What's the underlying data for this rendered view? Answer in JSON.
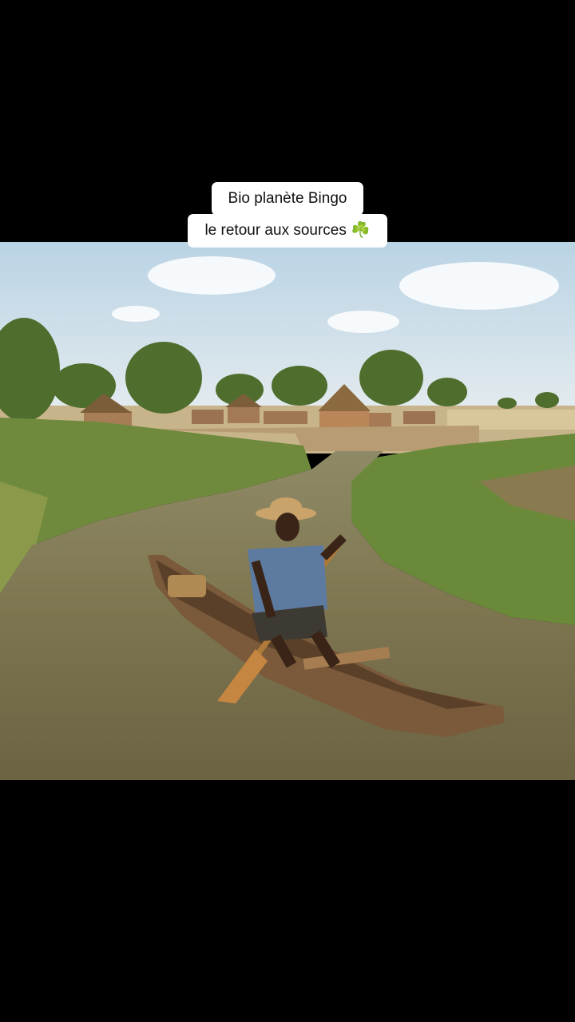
{
  "background_color": "#000000",
  "caption": {
    "line1": "Bio planète Bingo",
    "line2": "le retour aux sources",
    "emoji": "☘️"
  },
  "photo": {
    "subject": "man paddling a wooden dugout canoe on a river near a village of round thatched huts"
  }
}
